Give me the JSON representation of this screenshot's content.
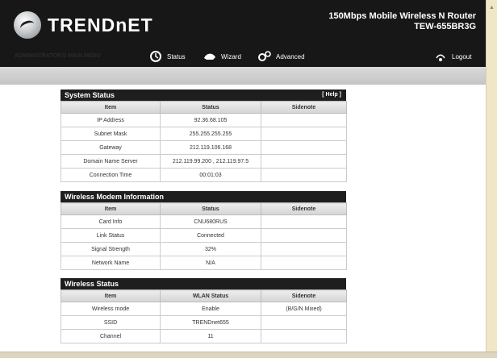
{
  "header": {
    "brand": "TRENDnET",
    "product_line1": "150Mbps Mobile Wireless N Router",
    "product_line2": "TEW-655BR3G",
    "admin_label": "ADMINISTRATOR'S MAIN MENU"
  },
  "nav": {
    "status": "Status",
    "wizard": "Wizard",
    "advanced": "Advanced",
    "logout": "Logout"
  },
  "colors": {
    "header_bg": "#171717",
    "panel_title_bg": "#1e1e1e",
    "page_bg": "#ffffff"
  },
  "system_status": {
    "title": "System Status",
    "help": "[ Help ]",
    "columns": [
      "Item",
      "Status",
      "Sidenote"
    ],
    "rows": [
      {
        "item": "IP Address",
        "status": "92.36.68.105",
        "note": ""
      },
      {
        "item": "Subnet Mask",
        "status": "255.255.255.255",
        "note": ""
      },
      {
        "item": "Gateway",
        "status": "212.119.106.168",
        "note": ""
      },
      {
        "item": "Domain Name Server",
        "status": "212.119.99.200 , 212.119.97.5",
        "note": ""
      },
      {
        "item": "Connection Time",
        "status": "00:01:03",
        "note": ""
      }
    ]
  },
  "modem_info": {
    "title": "Wireless Modem Information",
    "columns": [
      "Item",
      "Status",
      "Sidenote"
    ],
    "rows": [
      {
        "item": "Card Info",
        "status": "CNU680RUS",
        "note": ""
      },
      {
        "item": "Link Status",
        "status": "Connected",
        "note": ""
      },
      {
        "item": "Signal Strength",
        "status": "32%",
        "note": ""
      },
      {
        "item": "Network Name",
        "status": "N/A",
        "note": ""
      }
    ]
  },
  "wireless_status": {
    "title": "Wireless Status",
    "columns": [
      "Item",
      "WLAN Status",
      "Sidenote"
    ],
    "rows": [
      {
        "item": "Wireless mode",
        "status": "Enable",
        "note": "(B/G/N Mixed)"
      },
      {
        "item": "SSID",
        "status": "TRENDnet655",
        "note": ""
      },
      {
        "item": "Channel",
        "status": "11",
        "note": ""
      }
    ]
  }
}
